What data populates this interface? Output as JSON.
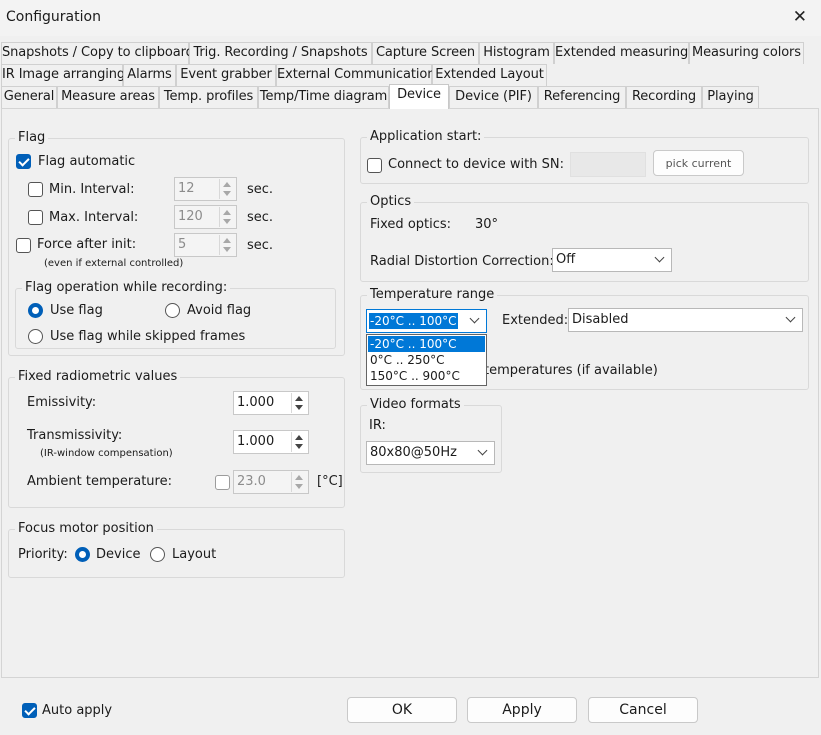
{
  "window": {
    "title": "Configuration",
    "close_icon": "close-icon"
  },
  "tabs": {
    "row1": [
      "Snapshots / Copy to clipboard",
      "Trig. Recording / Snapshots",
      "Capture Screen",
      "Histogram",
      "Extended measuring",
      "Measuring colors"
    ],
    "row2": [
      "IR Image arranging",
      "Alarms",
      "Event grabber",
      "External Communication",
      "Extended Layout"
    ],
    "row3": [
      "General",
      "Measure areas",
      "Temp. profiles",
      "Temp/Time diagram",
      "Device",
      "Device (PIF)",
      "Referencing",
      "Recording",
      "Playing"
    ],
    "active": "Device"
  },
  "flag": {
    "legend": "Flag",
    "automatic_label": "Flag automatic",
    "min_label": "Min. Interval:",
    "min_value": "12",
    "max_label": "Max. Interval:",
    "max_value": "120",
    "force_label": "Force after init:",
    "force_value": "5",
    "force_note": "(even if external controlled)",
    "unit": "sec.",
    "operation": {
      "legend": "Flag operation while recording:",
      "use_flag": "Use flag",
      "avoid_flag": "Avoid flag",
      "use_skipped": "Use flag while skipped frames"
    }
  },
  "radiometric": {
    "legend": "Fixed radiometric values",
    "emissivity_label": "Emissivity:",
    "emissivity_value": "1.000",
    "transmissivity_label": "Transmissivity:",
    "transmissivity_value": "1.000",
    "transmissivity_note": "(IR-window compensation)",
    "ambient_label": "Ambient temperature:",
    "ambient_value": "23.0",
    "ambient_unit": "[°C]"
  },
  "focus": {
    "legend": "Focus motor position",
    "priority_label": "Priority:",
    "device": "Device",
    "layout": "Layout"
  },
  "app_start": {
    "legend": "Application start:",
    "connect_label": "Connect to device with SN:",
    "sn_value": "",
    "pick_button": "pick current"
  },
  "optics": {
    "legend": "Optics",
    "fixed_label": "Fixed optics:",
    "fixed_value": "30°",
    "radial_label": "Radial Distortion Correction:",
    "radial_value": "Off"
  },
  "temp_range": {
    "legend": "Temperature range",
    "selected": "-20°C .. 100°C",
    "extended_label": "Extended:",
    "extended_value": "Disabled",
    "hidden_text": "temperatures (if available)",
    "options": [
      "-20°C .. 100°C",
      "0°C .. 250°C",
      "150°C .. 900°C"
    ]
  },
  "video": {
    "legend": "Video formats",
    "ir_label": "IR:",
    "ir_value": "80x80@50Hz"
  },
  "footer": {
    "auto_apply": "Auto apply",
    "ok": "OK",
    "apply": "Apply",
    "cancel": "Cancel"
  }
}
